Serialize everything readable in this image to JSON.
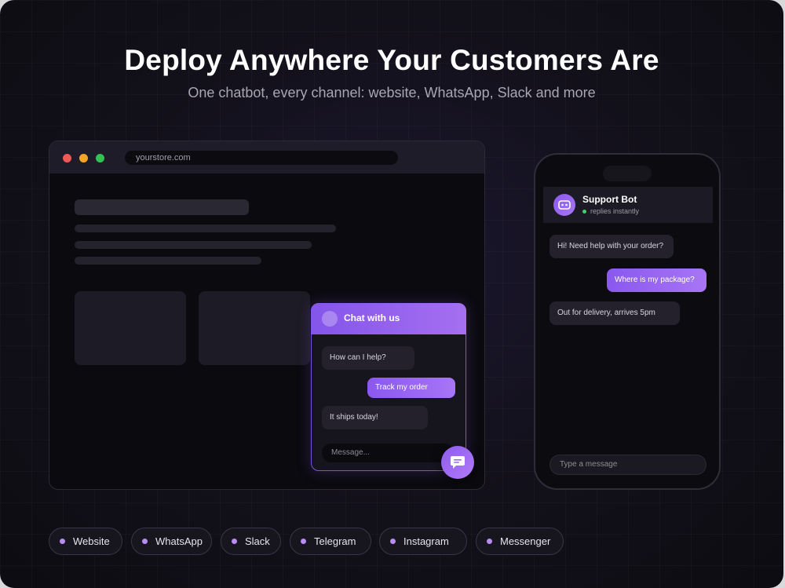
{
  "header": {
    "title": "Deploy Anywhere Your Customers Are",
    "subtitle": "One chatbot, every channel: website, WhatsApp, Slack and more"
  },
  "browser": {
    "url": "yourstore.com"
  },
  "widget": {
    "title": "Chat with us",
    "messages": [
      {
        "from": "bot",
        "text": "How can I help?"
      },
      {
        "from": "user",
        "text": "Track my order"
      },
      {
        "from": "bot",
        "text": "It ships today!"
      }
    ],
    "input_placeholder": "Message..."
  },
  "phone": {
    "bot_name": "Support Bot",
    "status": "replies instantly",
    "messages": [
      {
        "from": "bot",
        "text": "Hi! Need help with your order?"
      },
      {
        "from": "user",
        "text": "Where is my package?"
      },
      {
        "from": "bot",
        "text": "Out for delivery, arrives 5pm"
      }
    ],
    "input_placeholder": "Type a message"
  },
  "channels": [
    "Website",
    "WhatsApp",
    "Slack",
    "Telegram",
    "Instagram",
    "Messenger"
  ],
  "colors": {
    "accent": "#8b5cf6",
    "background": "#121019",
    "online": "#3ed26a"
  },
  "icons": {
    "fab": "chat-bubble-icon",
    "bot": "robot-icon"
  }
}
